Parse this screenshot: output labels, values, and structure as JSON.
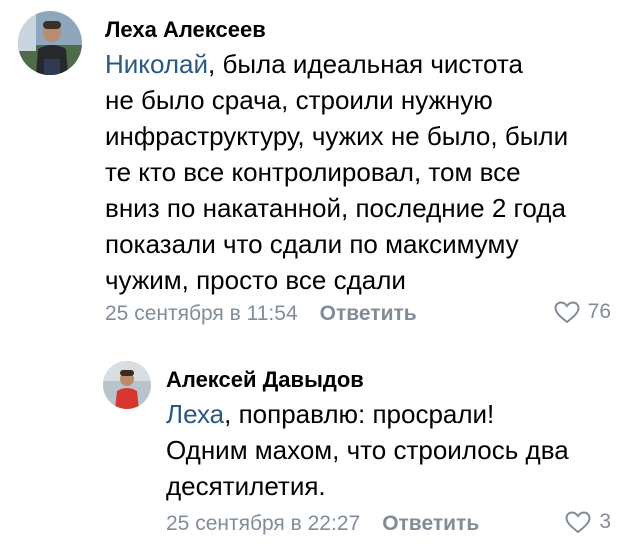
{
  "comments": [
    {
      "author": "Леха Алексеев",
      "mention": "Николай",
      "lines": [
        ", была идеальная чистота",
        "не было срача, строили нужную",
        "инфраструктуру, чужих не было, были",
        "те кто все контролировал, том все",
        "вниз по накатанной, последние 2 года",
        "показали что сдали по максимуму",
        "чужим, просто все сдали"
      ],
      "date": "25 сентября в 11:54",
      "reply_label": "Ответить",
      "likes": "76",
      "avatar_icon": "user-photo-icon"
    },
    {
      "author": "Алексей Давыдов",
      "mention": "Леха",
      "lines": [
        ", поправлю: просрали!",
        "Одним махом, что строилось два",
        "десятилетия."
      ],
      "date": "25 сентября в 22:27",
      "reply_label": "Ответить",
      "likes": "3",
      "avatar_icon": "user-photo-icon"
    }
  ],
  "colors": {
    "mention": "#2a5885",
    "meta": "#818c99",
    "text": "#000000"
  }
}
